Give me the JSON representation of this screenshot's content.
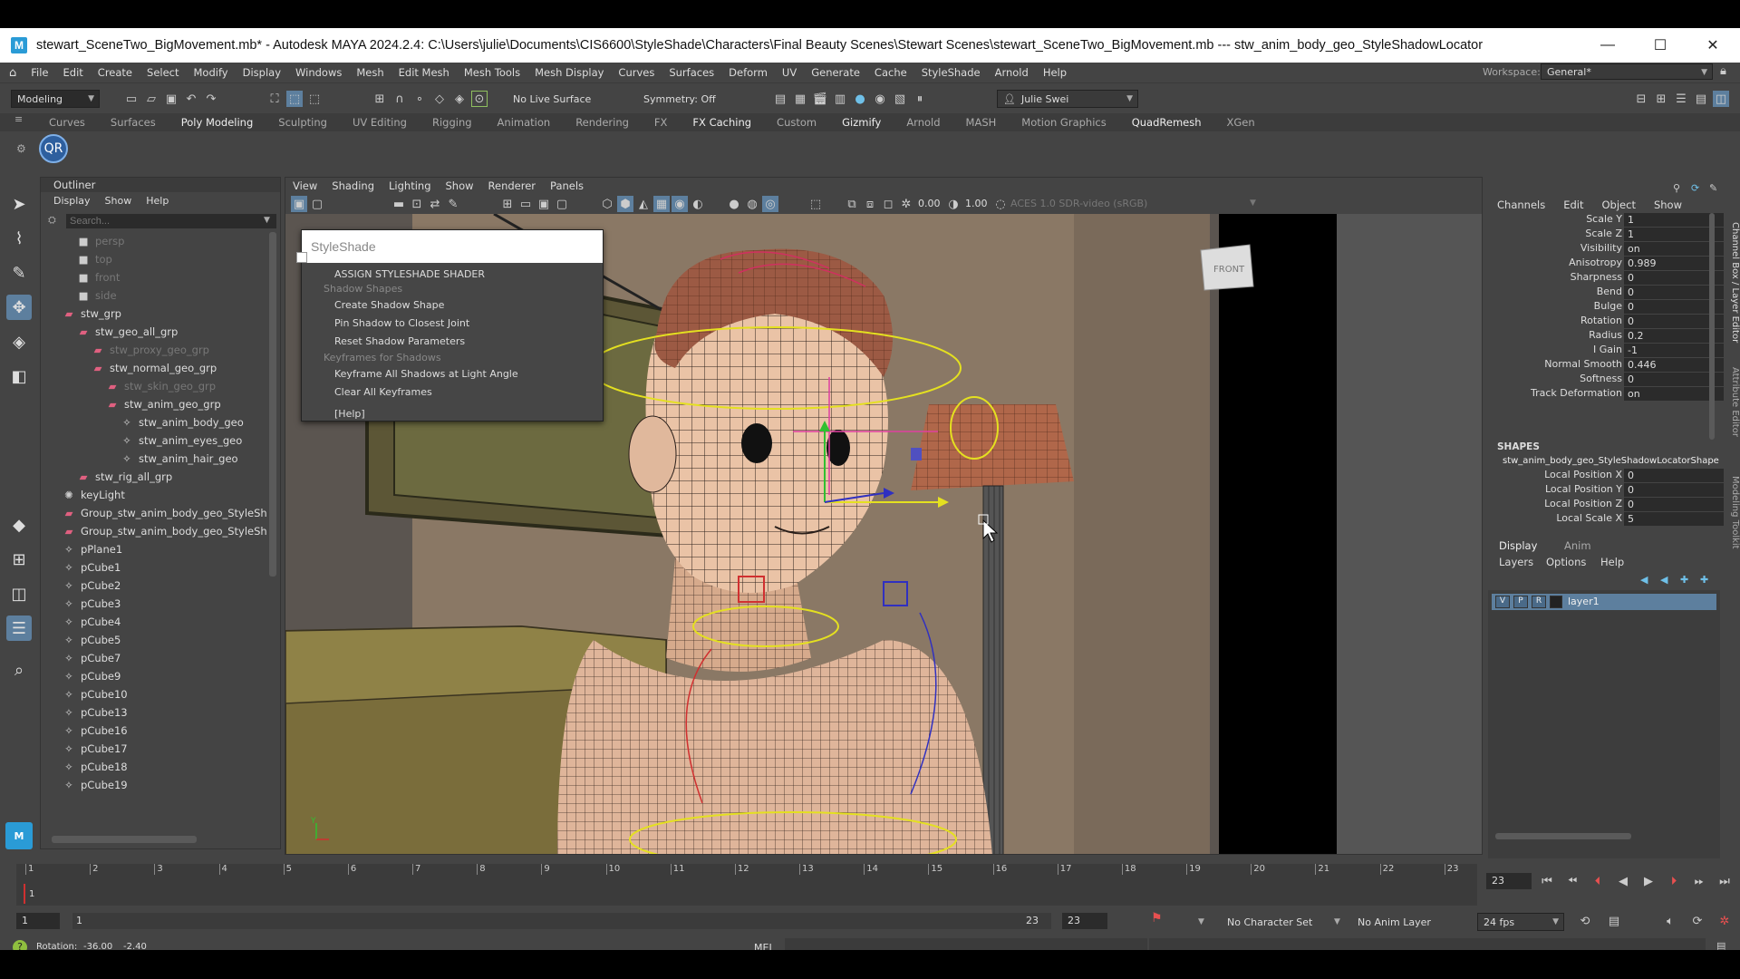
{
  "window": {
    "title": "stewart_SceneTwo_BigMovement.mb* - Autodesk MAYA 2024.2.4: C:\\Users\\julie\\Documents\\CIS6600\\StyleShade\\Characters\\Final Beauty Scenes\\Stewart Scenes\\stewart_SceneTwo_BigMovement.mb  ---  stw_anim_body_geo_StyleShadowLocator",
    "logo": "M",
    "minimize": "—",
    "maximize": "☐",
    "close": "✕"
  },
  "menubar": {
    "items": [
      "File",
      "Edit",
      "Create",
      "Select",
      "Modify",
      "Display",
      "Windows",
      "Mesh",
      "Edit Mesh",
      "Mesh Tools",
      "Mesh Display",
      "Curves",
      "Surfaces",
      "Deform",
      "UV",
      "Generate",
      "Cache",
      "StyleShade",
      "Arnold",
      "Help"
    ],
    "workspace_label": "Workspace:",
    "workspace_value": "General*"
  },
  "statusline": {
    "mode": "Modeling",
    "live_surface": "No Live Surface",
    "symmetry": "Symmetry: Off",
    "user": "Julie Swei"
  },
  "shelf": {
    "tabs": [
      "Curves",
      "Surfaces",
      "Poly Modeling",
      "Sculpting",
      "UV Editing",
      "Rigging",
      "Animation",
      "Rendering",
      "FX",
      "FX Caching",
      "Custom",
      "Gizmify",
      "Arnold",
      "MASH",
      "Motion Graphics",
      "QuadRemesh",
      "XGen"
    ],
    "qr_button": "QR"
  },
  "outliner": {
    "title": "Outliner",
    "menu": [
      "Display",
      "Show",
      "Help"
    ],
    "search_placeholder": "Search...",
    "items": [
      {
        "label": "persp",
        "icon": "camera-icon"
      },
      {
        "label": "top",
        "icon": "camera-icon"
      },
      {
        "label": "front",
        "icon": "camera-icon"
      },
      {
        "label": "side",
        "icon": "camera-icon"
      },
      {
        "label": "stw_grp",
        "icon": "group-icon"
      },
      {
        "label": "stw_geo_all_grp",
        "icon": "group-icon"
      },
      {
        "label": "stw_proxy_geo_grp",
        "icon": "group-icon"
      },
      {
        "label": "stw_normal_geo_grp",
        "icon": "group-icon"
      },
      {
        "label": "stw_skin_geo_grp",
        "icon": "group-icon"
      },
      {
        "label": "stw_anim_geo_grp",
        "icon": "group-icon"
      },
      {
        "label": "stw_anim_body_geo",
        "icon": "mesh-icon"
      },
      {
        "label": "stw_anim_eyes_geo",
        "icon": "mesh-icon"
      },
      {
        "label": "stw_anim_hair_geo",
        "icon": "mesh-icon"
      },
      {
        "label": "stw_rig_all_grp",
        "icon": "group-icon"
      },
      {
        "label": "keyLight",
        "icon": "light-icon"
      },
      {
        "label": "Group_stw_anim_body_geo_StyleSha",
        "icon": "group-icon"
      },
      {
        "label": "Group_stw_anim_body_geo_StyleSha",
        "icon": "group-icon"
      },
      {
        "label": "pPlane1",
        "icon": "mesh-icon"
      },
      {
        "label": "pCube1",
        "icon": "mesh-icon"
      },
      {
        "label": "pCube2",
        "icon": "mesh-icon"
      },
      {
        "label": "pCube3",
        "icon": "mesh-icon"
      },
      {
        "label": "pCube4",
        "icon": "mesh-icon"
      },
      {
        "label": "pCube5",
        "icon": "mesh-icon"
      },
      {
        "label": "pCube7",
        "icon": "mesh-icon"
      },
      {
        "label": "pCube9",
        "icon": "mesh-icon"
      },
      {
        "label": "pCube10",
        "icon": "mesh-icon"
      },
      {
        "label": "pCube13",
        "icon": "mesh-icon"
      },
      {
        "label": "pCube16",
        "icon": "mesh-icon"
      },
      {
        "label": "pCube17",
        "icon": "mesh-icon"
      },
      {
        "label": "pCube18",
        "icon": "mesh-icon"
      },
      {
        "label": "pCube19",
        "icon": "mesh-icon"
      }
    ]
  },
  "viewport": {
    "menu": [
      "View",
      "Shading",
      "Lighting",
      "Show",
      "Renderer",
      "Panels"
    ],
    "field1": "0.00",
    "field2": "1.00",
    "colorspace": "ACES 1.0 SDR-video (sRGB)",
    "viewcube_label": "FRONT",
    "axis_label": "Y"
  },
  "styleshade_menu": {
    "title": "StyleShade",
    "assign": "ASSIGN STYLESHADE SHADER",
    "section1": "Shadow Shapes",
    "create": "Create Shadow Shape",
    "pin": "Pin Shadow to Closest Joint",
    "reset": "Reset Shadow Parameters",
    "section2": "Keyframes for Shadows",
    "keyframe_all": "Keyframe All Shadows at Light Angle",
    "clear": "Clear All Keyframes",
    "help": "[Help]"
  },
  "channelbox": {
    "menu": [
      "Channels",
      "Edit",
      "Object",
      "Show"
    ],
    "rows": [
      {
        "label": "Scale Y",
        "value": "1"
      },
      {
        "label": "Scale Z",
        "value": "1"
      },
      {
        "label": "Visibility",
        "value": "on"
      },
      {
        "label": "Anisotropy",
        "value": "0.989"
      },
      {
        "label": "Sharpness",
        "value": "0"
      },
      {
        "label": "Bend",
        "value": "0"
      },
      {
        "label": "Bulge",
        "value": "0"
      },
      {
        "label": "Rotation",
        "value": "0"
      },
      {
        "label": "Radius",
        "value": "0.2"
      },
      {
        "label": "I Gain",
        "value": "-1"
      },
      {
        "label": "Normal Smooth",
        "value": "0.446"
      },
      {
        "label": "Softness",
        "value": "0"
      },
      {
        "label": "Track Deformation",
        "value": "on"
      }
    ],
    "shapes_header": "SHAPES",
    "shape_name": "stw_anim_body_geo_StyleShadowLocatorShape",
    "shape_rows": [
      {
        "label": "Local Position X",
        "value": "0"
      },
      {
        "label": "Local Position Y",
        "value": "0"
      },
      {
        "label": "Local Position Z",
        "value": "0"
      },
      {
        "label": "Local Scale X",
        "value": "5"
      }
    ],
    "side_tabs": [
      "Channel Box / Layer Editor",
      "Attribute Editor",
      "Modeling Toolkit"
    ],
    "layer_tabs": [
      "Display",
      "Anim"
    ],
    "layer_menu": [
      "Layers",
      "Options",
      "Help"
    ],
    "layer": {
      "v": "V",
      "p": "P",
      "r": "R",
      "name": "layer1"
    }
  },
  "timeline": {
    "ticks": [
      "1",
      "2",
      "3",
      "4",
      "5",
      "6",
      "7",
      "8",
      "9",
      "10",
      "11",
      "12",
      "13",
      "14",
      "15",
      "16",
      "17",
      "18",
      "19",
      "20",
      "21",
      "22",
      "23"
    ],
    "current_marker": "1",
    "current_frame": "23",
    "range_start_outer": "1",
    "range_start_inner": "1",
    "range_end_inner": "23",
    "range_end_outer": "23",
    "character_set": "No Character Set",
    "anim_layer": "No Anim Layer",
    "fps": "24 fps"
  },
  "commandline": {
    "help_text_label": "Rotation:",
    "help_value1": "-36.00",
    "help_value2": "-2.40",
    "lang": "MEL"
  }
}
